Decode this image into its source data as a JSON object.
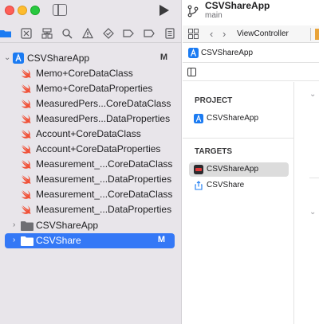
{
  "navigator": {
    "project_row": {
      "label": "CSVShareApp",
      "badge": "M"
    },
    "files": [
      {
        "label": "Memo+CoreDataClass"
      },
      {
        "label": "Memo+CoreDataProperties"
      },
      {
        "label": "MeasuredPers...CoreDataClass"
      },
      {
        "label": "MeasuredPers...DataProperties"
      },
      {
        "label": "Account+CoreDataClass"
      },
      {
        "label": "Account+CoreDataProperties"
      },
      {
        "label": "Measurement_...CoreDataClass"
      },
      {
        "label": "Measurement_...DataProperties"
      },
      {
        "label": "Measurement_...CoreDataClass"
      },
      {
        "label": "Measurement_...DataProperties"
      }
    ],
    "folders": [
      {
        "label": "CSVShareApp",
        "badge": "",
        "selected": false
      },
      {
        "label": "CSVShare",
        "badge": "M",
        "selected": true
      }
    ]
  },
  "header": {
    "project_name": "CSVShareApp",
    "branch": "main"
  },
  "tabbar": {
    "tab_label": "ViewController"
  },
  "breadcrumb": {
    "label": "CSVShareApp"
  },
  "project_list": {
    "project_heading": "PROJECT",
    "project_item": "CSVShareApp",
    "targets_heading": "TARGETS",
    "targets": [
      {
        "label": "CSVShareApp",
        "selected": true
      },
      {
        "label": "CSVShare",
        "selected": false
      }
    ]
  },
  "colors": {
    "selection": "#3478f6",
    "swift_orange": "#f05138",
    "folder_gray": "#6e6e73",
    "xcode_blue": "#1b7bf2"
  }
}
